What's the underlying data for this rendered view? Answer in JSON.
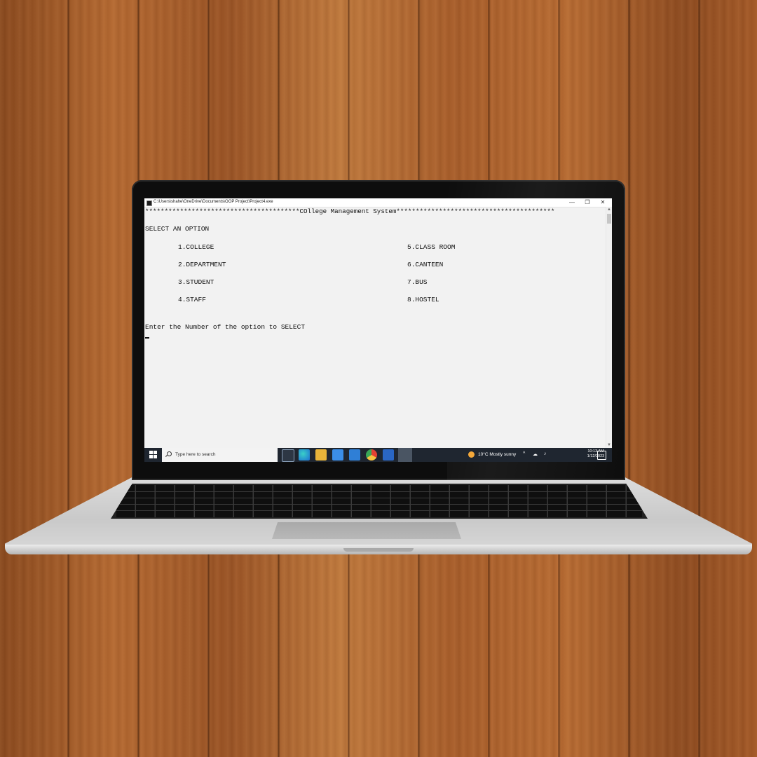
{
  "window": {
    "title": "C:\\Users\\shahe\\OneDrive\\Documents\\OOP Project\\Project4.exe",
    "minimize": "—",
    "maximize": "❐",
    "close": "✕"
  },
  "console": {
    "header": "****************************************COllege Management System*****************************************",
    "prompt_title": "SELECT AN OPTION",
    "options_left": [
      "1.COLLEGE",
      "2.DEPARTMENT",
      "3.STUDENT",
      "4.STAFF"
    ],
    "options_right": [
      "5.CLASS ROOM",
      "6.CANTEEN",
      "7.BUS",
      "8.HOSTEL"
    ],
    "instruction": "Enter the Number of the option to SELECT"
  },
  "taskbar": {
    "search_placeholder": "Type here to search",
    "weather": "10°C  Mostly sunny",
    "time": "10:13 AM",
    "date": "1/12/2023",
    "app_icons": [
      "task-view-icon",
      "edge-icon",
      "file-explorer-icon",
      "store-icon",
      "mail-icon",
      "chrome-icon",
      "app-icon",
      "app-active-icon"
    ]
  },
  "colors": {
    "console_bg": "#f2f2f2",
    "taskbar_bg": "#1f2630",
    "wood": "#a85e2b"
  }
}
